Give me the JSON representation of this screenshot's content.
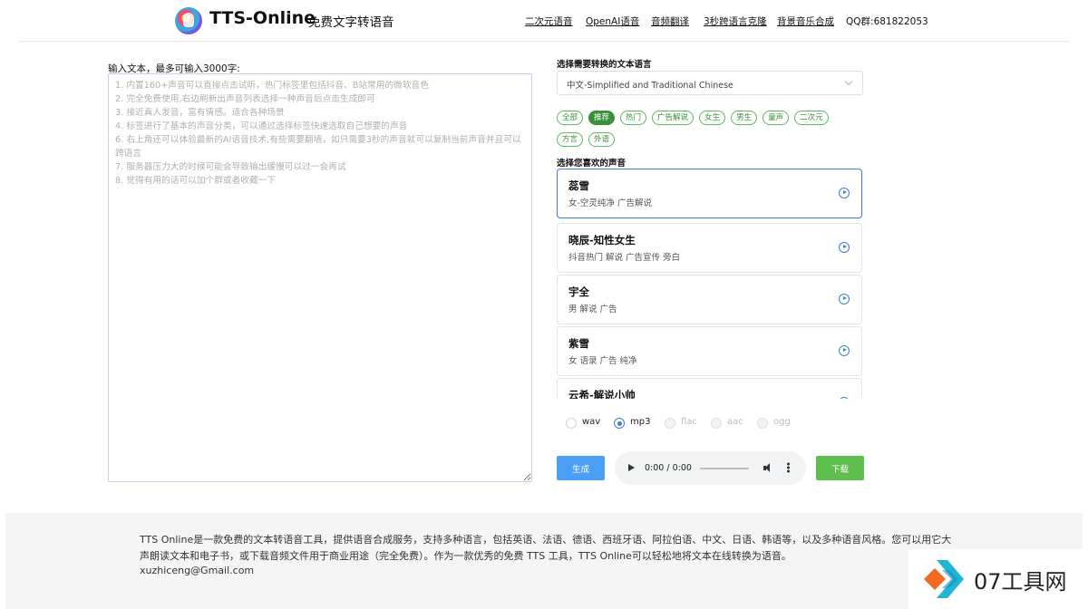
{
  "header": {
    "brand": "TTS-Online",
    "subtitle": "免费文字转语音",
    "nav": [
      "二次元语音",
      "OpenAI语音",
      "音频翻译",
      "3秒跨语言克隆",
      "背景音乐合成"
    ],
    "qq_group": "QQ群:681822053"
  },
  "editor": {
    "label": "输入文本，最多可输入3000字:",
    "placeholder": "1. 内置160+声音可以直接点击试听，热门标签里包括抖音、B站常用的微软音色\n2. 完全免费使用,右边刷新出声音列表选择一种声音后点击生成即可\n3. 接近真人发音，富有情感。适合各种场景\n4. 标签进行了基本的声音分类，可以通过选择标签快速选取自己想要的声音\n6. 右上角还可以体验最新的AI语音技术,有些需要翻墙，如只需要3秒的声音就可以复制当前声音并且可以跨语言\n7. 服务器压力大的时候可能会导致输出缓慢可以过一会再试\n8. 觉得有用的话可以加个群或者收藏一下"
  },
  "language": {
    "label": "选择需要转换的文本语言",
    "selected": "中文-Simplified and Traditional Chinese"
  },
  "tags": {
    "row1": [
      "全部",
      "推荐",
      "热门",
      "广告解说",
      "女生",
      "男生",
      "童声",
      "二次元"
    ],
    "row2": [
      "方言",
      "外语"
    ],
    "active": "推荐"
  },
  "voices": {
    "label": "选择您喜欢的声音",
    "items": [
      {
        "name": "蕊雪",
        "desc": "女-空灵纯净 广告解说"
      },
      {
        "name": "晓辰-知性女生",
        "desc": "抖音热门 解说 广告宣传 旁白"
      },
      {
        "name": "宇全",
        "desc": "男 解说 广告"
      },
      {
        "name": "紫雪",
        "desc": "女 语录 广告 纯净"
      },
      {
        "name": "云希-解说小帅",
        "desc": ""
      }
    ],
    "selected_index": 0
  },
  "formats": {
    "options": [
      "wav",
      "mp3",
      "flac",
      "aac",
      "ogg"
    ],
    "selected": "mp3",
    "disabled": [
      "flac",
      "aac",
      "ogg"
    ]
  },
  "actions": {
    "generate": "生成",
    "download": "下载"
  },
  "player": {
    "time": "0:00 / 0:00"
  },
  "footer": {
    "text": "TTS Online是一款免费的文本转语音工具，提供语音合成服务，支持多种语言，包括英语、法语、德语、西班牙语、阿拉伯语、中文、日语、韩语等，以及多种语音风格。您可以用它大声朗读文本和电子书，或下载音频文件用于商业用途（完全免费）。作为一款优秀的免费 TTS 工具，TTS Online可以轻松地将文本在线转换为语音。",
    "email": "xuzhiceng@Gmail.com"
  },
  "watermark": {
    "text": "07工具网"
  }
}
